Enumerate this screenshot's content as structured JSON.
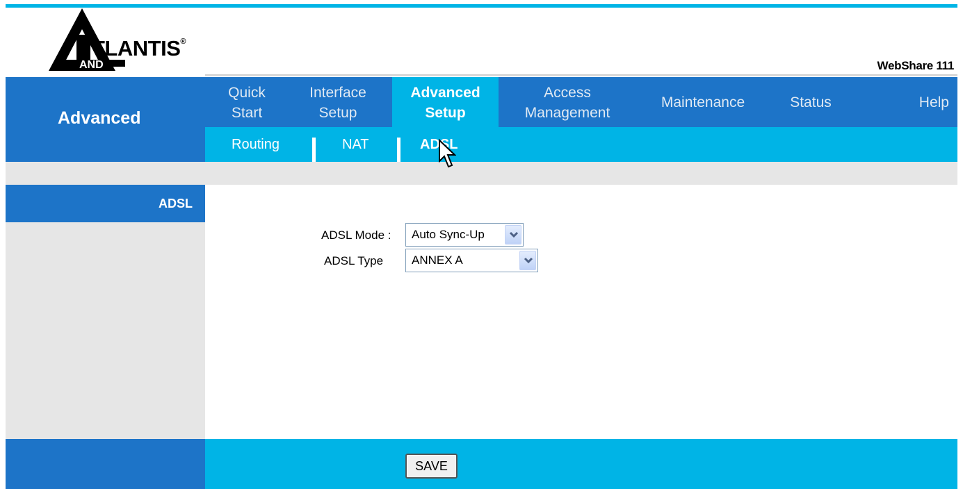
{
  "brand": {
    "logo_text": "TLANTIS",
    "logo_sub": "AND",
    "logo_reg": "®",
    "product_name": "WebShare",
    "product_model": "111"
  },
  "sidebar": {
    "header_label": "Advanced",
    "section_label": "ADSL"
  },
  "nav": {
    "items": [
      {
        "label_line1": "Quick",
        "label_line2": "Start"
      },
      {
        "label_line1": "Interface",
        "label_line2": "Setup"
      },
      {
        "label_line1": "Advanced",
        "label_line2": "Setup"
      },
      {
        "label_line1": "Access",
        "label_line2": "Management"
      },
      {
        "label": "Maintenance"
      },
      {
        "label": "Status"
      },
      {
        "label": "Help"
      }
    ],
    "active_index": 2
  },
  "subnav": {
    "items": [
      "Routing",
      "NAT",
      "ADSL"
    ],
    "active": "ADSL"
  },
  "form": {
    "mode_label": "ADSL Mode :",
    "mode_value": "Auto Sync-Up",
    "type_label": "ADSL Type",
    "type_value": "ANNEX A"
  },
  "footer": {
    "save_label": "SAVE"
  },
  "colors": {
    "dark_blue": "#1d74c8",
    "light_blue": "#00b4e6",
    "grey": "#e6e6e6"
  }
}
